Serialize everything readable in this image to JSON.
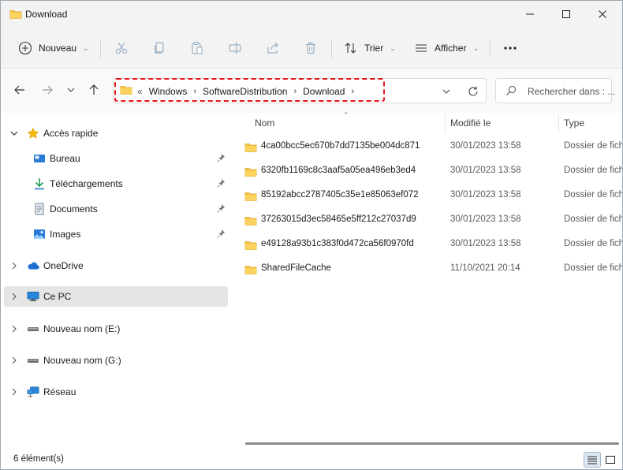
{
  "window": {
    "title": "Download",
    "controls": {
      "minimize": "minimize",
      "maximize": "maximize",
      "close": "close"
    }
  },
  "commandbar": {
    "new_label": "Nouveau",
    "sort_label": "Trier",
    "view_label": "Afficher",
    "icons": [
      "cut-icon",
      "copy-icon",
      "paste-icon",
      "rename-icon",
      "share-icon",
      "delete-icon",
      "more-icon"
    ]
  },
  "address": {
    "overflow": "«",
    "crumbs": [
      "Windows",
      "SoftwareDistribution",
      "Download"
    ],
    "highlight_color": "#e3131e"
  },
  "search": {
    "placeholder": "Rechercher dans : ..."
  },
  "nav": {
    "items": [
      {
        "label": "Accès rapide",
        "icon": "star-icon",
        "expanded": true
      },
      {
        "label": "Bureau",
        "icon": "desktop-icon",
        "pinned": true
      },
      {
        "label": "Téléchargements",
        "icon": "download-icon",
        "pinned": true
      },
      {
        "label": "Documents",
        "icon": "documents-icon",
        "pinned": true
      },
      {
        "label": "Images",
        "icon": "images-icon",
        "pinned": true
      },
      {
        "label": "OneDrive",
        "icon": "cloud-icon"
      },
      {
        "label": "Ce PC",
        "icon": "pc-icon",
        "selected": true
      },
      {
        "label": "Nouveau nom (E:)",
        "icon": "drive-icon"
      },
      {
        "label": "Nouveau nom (G:)",
        "icon": "drive-icon"
      },
      {
        "label": "Réseau",
        "icon": "network-icon"
      }
    ]
  },
  "columns": {
    "name": "Nom",
    "modified": "Modifié le",
    "type": "Type"
  },
  "files": [
    {
      "name": "4ca00bcc5ec670b7dd7135be004dc871",
      "modified": "30/01/2023 13:58",
      "type": "Dossier de fichiers"
    },
    {
      "name": "6320fb1169c8c3aaf5a05ea496eb3ed4",
      "modified": "30/01/2023 13:58",
      "type": "Dossier de fichiers"
    },
    {
      "name": "85192abcc2787405c35e1e85063ef072",
      "modified": "30/01/2023 13:58",
      "type": "Dossier de fichiers"
    },
    {
      "name": "37263015d3ec58465e5ff212c27037d9",
      "modified": "30/01/2023 13:58",
      "type": "Dossier de fichiers"
    },
    {
      "name": "e49128a93b1c383f0d472ca56f0970fd",
      "modified": "30/01/2023 13:58",
      "type": "Dossier de fichiers"
    },
    {
      "name": "SharedFileCache",
      "modified": "11/10/2021 20:14",
      "type": "Dossier de fichiers"
    }
  ],
  "status": {
    "count_text": "6 élément(s)"
  },
  "colors": {
    "folder": "#f8c33f",
    "folder_dark": "#e0a526",
    "selection": "#e5e5e5",
    "accent": "#0067c0"
  }
}
